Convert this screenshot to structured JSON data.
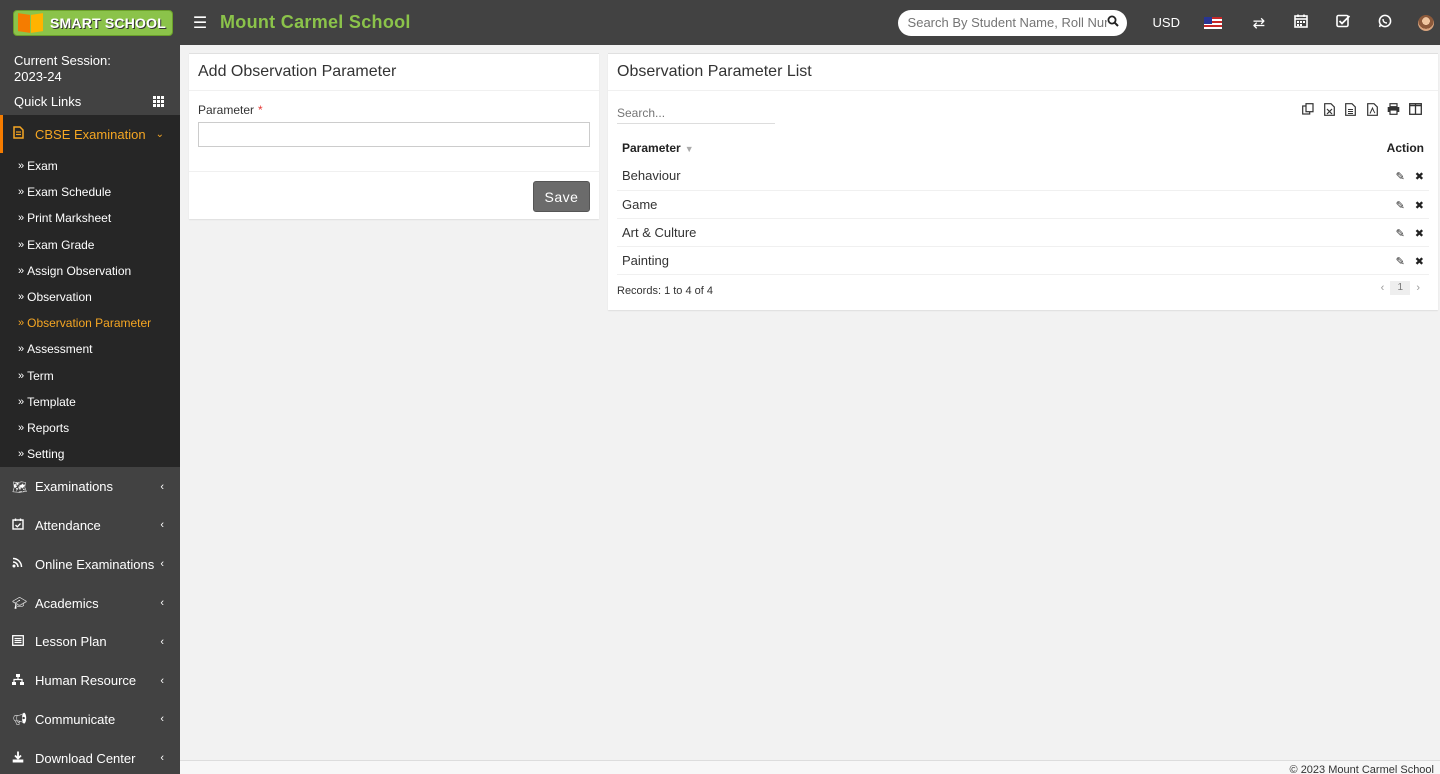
{
  "header": {
    "logo_text": "SMART SCHOOL",
    "school_name": "Mount Carmel School",
    "search_placeholder": "Search By Student Name, Roll Number, Enroll Number, National Id, Local Id Etc.",
    "currency": "USD"
  },
  "sidebar": {
    "session_label": "Current Session:",
    "session_value": "2023-24",
    "quick_links": "Quick Links",
    "active_group": "CBSE Examination",
    "submenu": [
      "Exam",
      "Exam Schedule",
      "Print Marksheet",
      "Exam Grade",
      "Assign Observation",
      "Observation",
      "Observation Parameter",
      "Assessment",
      "Term",
      "Template",
      "Reports",
      "Setting"
    ],
    "items": [
      "Examinations",
      "Attendance",
      "Online Examinations",
      "Academics",
      "Lesson Plan",
      "Human Resource",
      "Communicate",
      "Download Center"
    ]
  },
  "add_panel": {
    "title": "Add Observation Parameter",
    "field_label": "Parameter",
    "required_mark": "*",
    "save_label": "Save"
  },
  "list_panel": {
    "title": "Observation Parameter List",
    "search_placeholder": "Search...",
    "col_parameter": "Parameter",
    "col_action": "Action",
    "rows": [
      "Behaviour",
      "Game",
      "Art & Culture",
      "Painting"
    ],
    "records": "Records: 1 to 4 of 4",
    "page": "1"
  },
  "footer": {
    "copyright": "© 2023 Mount Carmel School"
  }
}
